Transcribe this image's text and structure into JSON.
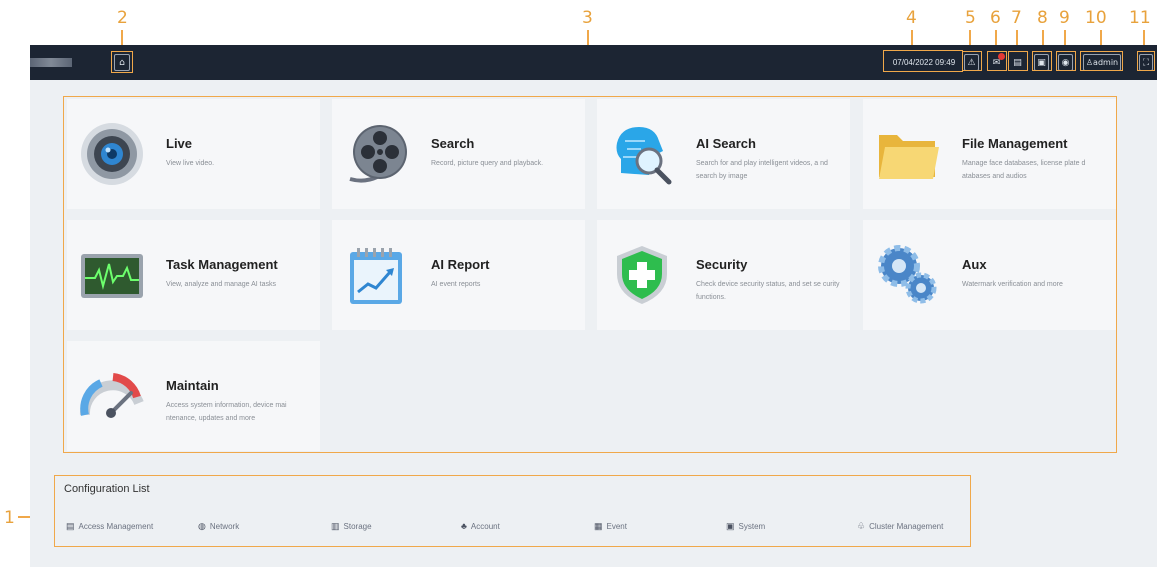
{
  "topbar": {
    "datetime": "07/04/2022 09:49",
    "user": "admin",
    "icons": {
      "home": "⌂",
      "alarm": "⚠",
      "notification": "✉",
      "clipboard": "▤",
      "display": "▣",
      "eye": "◉",
      "user": "♙",
      "fullscreen": "⛶"
    }
  },
  "callouts": [
    "1",
    "2",
    "3",
    "4",
    "5",
    "6",
    "7",
    "8",
    "9",
    "10",
    "11"
  ],
  "cards": [
    {
      "title": "Live",
      "desc": "View live video."
    },
    {
      "title": "Search",
      "desc": "Record, picture query and playback."
    },
    {
      "title": "AI Search",
      "desc": "Search for and play intelligent videos, a nd search by image"
    },
    {
      "title": "File Management",
      "desc": "Manage face databases, license plate d atabases and audios"
    },
    {
      "title": "Task Management",
      "desc": "View, analyze and manage AI tasks"
    },
    {
      "title": "AI Report",
      "desc": "AI event reports"
    },
    {
      "title": "Security",
      "desc": "Check device security status, and set se curity functions."
    },
    {
      "title": "Aux",
      "desc": "Watermark verification and more"
    },
    {
      "title": "Maintain",
      "desc": "Access system information, device mai ntenance, updates and more"
    }
  ],
  "config": {
    "title": "Configuration List",
    "items": [
      {
        "label": "Access Management",
        "glyph": "▤"
      },
      {
        "label": "Network",
        "glyph": "◍"
      },
      {
        "label": "Storage",
        "glyph": "▥"
      },
      {
        "label": "Account",
        "glyph": "♣"
      },
      {
        "label": "Event",
        "glyph": "▦"
      },
      {
        "label": "System",
        "glyph": "▣"
      },
      {
        "label": "Cluster Management",
        "glyph": "♧"
      }
    ]
  },
  "colors": {
    "accent": "#f0a84a",
    "topbar": "#1c2533",
    "background": "#edf0f3",
    "card": "#f6f7f9"
  }
}
